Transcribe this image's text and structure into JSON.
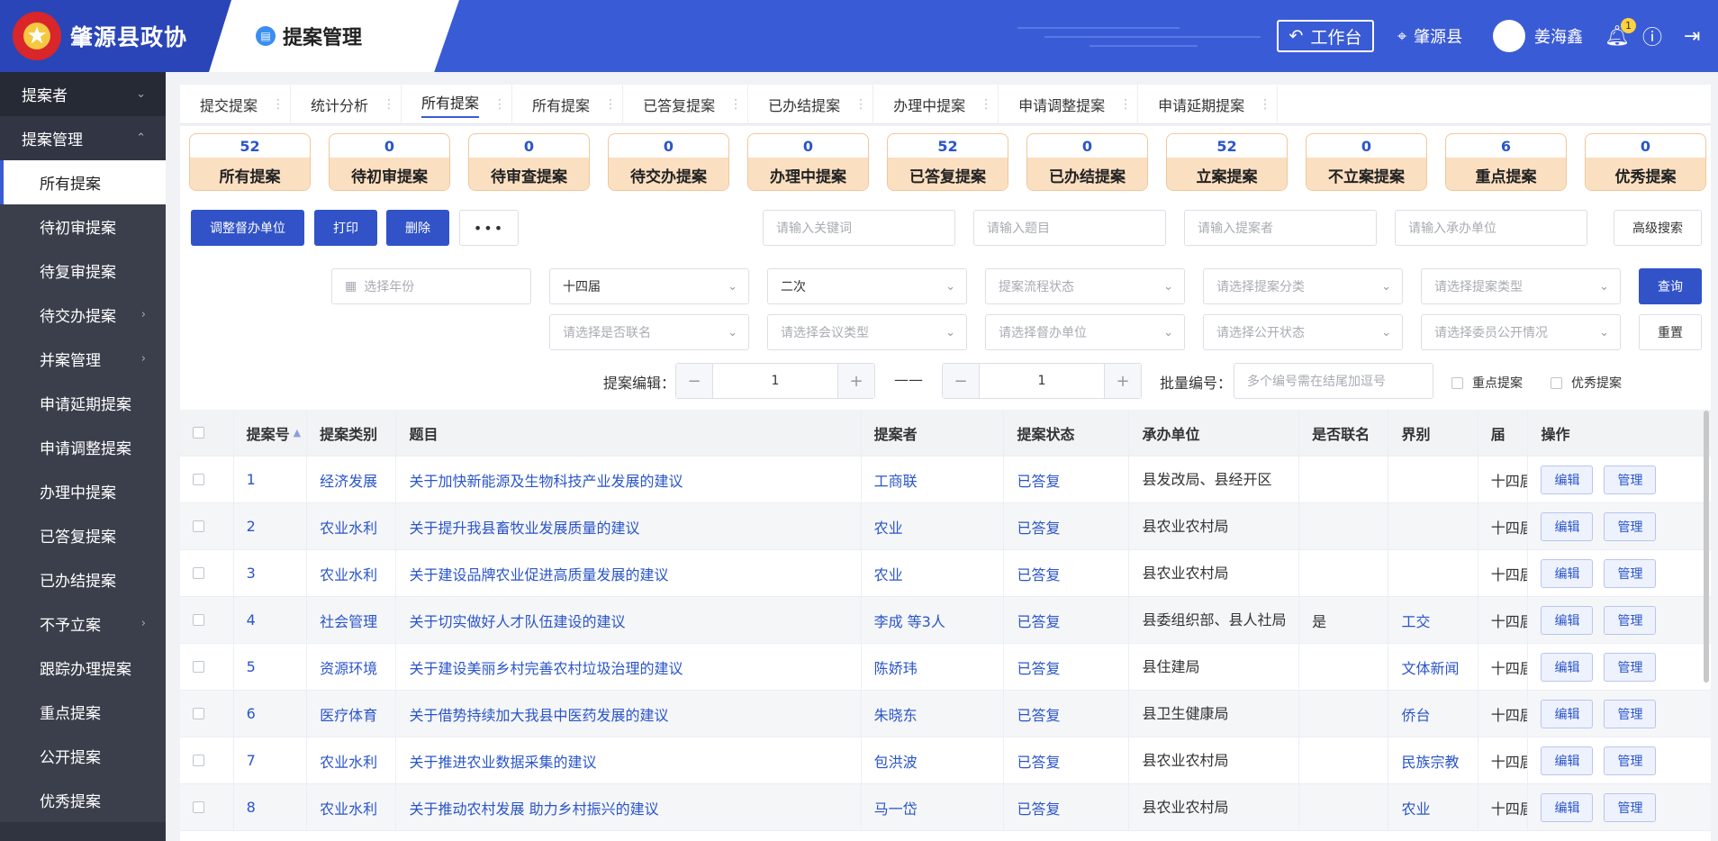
{
  "header": {
    "brand": "肇源县政协",
    "module_title": "提案管理",
    "workbench_label": "工作台",
    "location": "肇源县",
    "user_name": "姜海鑫",
    "notifications": "1"
  },
  "sidebar": {
    "items": [
      {
        "label": "提案者",
        "kind": "group",
        "chevron": "⌄"
      },
      {
        "label": "提案管理",
        "kind": "open",
        "chevron": "⌃"
      },
      {
        "label": "所有提案",
        "kind": "active",
        "chevron": ""
      },
      {
        "label": "待初审提案",
        "kind": "sub",
        "chevron": ""
      },
      {
        "label": "待复审提案",
        "kind": "sub",
        "chevron": ""
      },
      {
        "label": "待交办提案",
        "kind": "sub",
        "chevron": "›"
      },
      {
        "label": "并案管理",
        "kind": "sub",
        "chevron": "›"
      },
      {
        "label": "申请延期提案",
        "kind": "sub",
        "chevron": ""
      },
      {
        "label": "申请调整提案",
        "kind": "sub",
        "chevron": ""
      },
      {
        "label": "办理中提案",
        "kind": "sub",
        "chevron": ""
      },
      {
        "label": "已答复提案",
        "kind": "sub",
        "chevron": ""
      },
      {
        "label": "已办结提案",
        "kind": "sub",
        "chevron": ""
      },
      {
        "label": "不予立案",
        "kind": "sub",
        "chevron": "›"
      },
      {
        "label": "跟踪办理提案",
        "kind": "sub",
        "chevron": ""
      },
      {
        "label": "重点提案",
        "kind": "sub",
        "chevron": ""
      },
      {
        "label": "公开提案",
        "kind": "sub",
        "chevron": ""
      },
      {
        "label": "优秀提案",
        "kind": "sub",
        "chevron": ""
      }
    ]
  },
  "tabs": [
    "提交提案",
    "统计分析",
    "所有提案",
    "所有提案",
    "已答复提案",
    "已办结提案",
    "办理中提案",
    "申请调整提案",
    "申请延期提案"
  ],
  "active_tab": 2,
  "stats": [
    {
      "num": "52",
      "label": "所有提案"
    },
    {
      "num": "0",
      "label": "待初审提案"
    },
    {
      "num": "0",
      "label": "待审查提案"
    },
    {
      "num": "0",
      "label": "待交办提案"
    },
    {
      "num": "0",
      "label": "办理中提案"
    },
    {
      "num": "52",
      "label": "已答复提案"
    },
    {
      "num": "0",
      "label": "已办结提案"
    },
    {
      "num": "52",
      "label": "立案提案"
    },
    {
      "num": "0",
      "label": "不立案提案"
    },
    {
      "num": "6",
      "label": "重点提案"
    },
    {
      "num": "0",
      "label": "优秀提案"
    }
  ],
  "toolbar": {
    "adjust": "调整督办单位",
    "print": "打印",
    "delete": "删除",
    "more": "•••",
    "advanced": "高级搜索",
    "query": "查询",
    "reset": "重置"
  },
  "search": {
    "keyword": "请输入关键词",
    "title": "请输入题目",
    "proposer": "请输入提案者",
    "unit": "请输入承办单位",
    "year": "选择年份"
  },
  "filters": {
    "session": "十四届",
    "meeting": "二次",
    "flow": "提案流程状态",
    "category": "请选择提案分类",
    "type": "请选择提案类型",
    "joint": "请选择是否联名",
    "meeting_type": "请选择会议类型",
    "supervisor": "请选择督办单位",
    "public_status": "请选择公开状态",
    "member_public": "请选择委员公开情况"
  },
  "numbering": {
    "label": "提案编辑：",
    "from": "1",
    "dash": "——",
    "to": "1",
    "batch_label": "批量编号：",
    "batch_placeholder": "多个编号需在结尾加逗号",
    "key_check": "重点提案",
    "excellent_check": "优秀提案"
  },
  "table": {
    "headers": [
      "提案号",
      "提案类别",
      "题目",
      "提案者",
      "提案状态",
      "承办单位",
      "是否联名",
      "界别",
      "届",
      "操作"
    ],
    "edit": "编辑",
    "manage": "管理",
    "rows": [
      [
        "1",
        "经济发展",
        "关于加快新能源及生物科技产业发展的建议",
        "工商联",
        "已答复",
        "县发改局、县经开区",
        "",
        "",
        "十四届"
      ],
      [
        "2",
        "农业水利",
        "关于提升我县畜牧业发展质量的建议",
        "农业",
        "已答复",
        "县农业农村局",
        "",
        "",
        "十四届"
      ],
      [
        "3",
        "农业水利",
        "关于建设品牌农业促进高质量发展的建议",
        "农业",
        "已答复",
        "县农业农村局",
        "",
        "",
        "十四届"
      ],
      [
        "4",
        "社会管理",
        "关于切实做好人才队伍建设的建议",
        "李成 等3人",
        "已答复",
        "县委组织部、县人社局",
        "是",
        "工交",
        "十四届"
      ],
      [
        "5",
        "资源环境",
        "关于建设美丽乡村完善农村垃圾治理的建议",
        "陈娇玮",
        "已答复",
        "县住建局",
        "",
        "文体新闻",
        "十四届"
      ],
      [
        "6",
        "医疗体育",
        "关于借势持续加大我县中医药发展的建议",
        "朱晓东",
        "已答复",
        "县卫生健康局",
        "",
        "侨台",
        "十四届"
      ],
      [
        "7",
        "农业水利",
        "关于推进农业数据采集的建议",
        "包洪波",
        "已答复",
        "县农业农村局",
        "",
        "民族宗教",
        "十四届"
      ],
      [
        "8",
        "农业水利",
        "关于推动农村发展 助力乡村振兴的建议",
        "马一岱",
        "已答复",
        "县农业农村局",
        "",
        "农业",
        "十四届"
      ]
    ]
  },
  "colors": {
    "header": "#3a5bd6",
    "sidebar": "#2f3440",
    "accent": "#3153c7",
    "stat_label": "#fbdfc1"
  }
}
